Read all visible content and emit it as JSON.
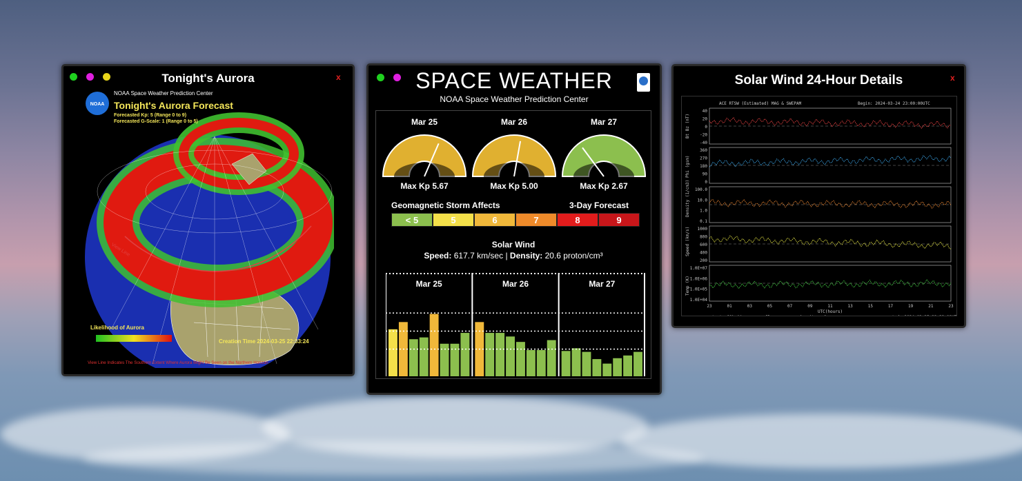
{
  "aurora_window": {
    "title": "Tonight's Aurora",
    "close": "x",
    "org": "NOAA Space Weather Prediction Center",
    "logo_text": "NOAA",
    "forecast_title": "Tonight's Aurora Forecast",
    "kp_line": "Forecasted Kp: 5 (Range 0 to 9)",
    "g_line": "Forecasted G-Scale: 1 (Range 0 to 5)",
    "likelihood_label": "Likelihood of Aurora",
    "view_line_label": "View Line",
    "creation_time": "Creation Time 2024-03-25 22:33:24",
    "footer": "View Line Indicates The Southern Extent Where Aurora Might Be Seen on the Northern Horizon"
  },
  "space_weather": {
    "title": "SPACE WEATHER",
    "subtitle": "NOAA Space Weather Prediction Center",
    "gauges": [
      {
        "date": "Mar 25",
        "kp_label": "Max Kp 5.67",
        "kp": 5.67,
        "color": "#e0b030"
      },
      {
        "date": "Mar 26",
        "kp_label": "Max Kp 5.00",
        "kp": 5.0,
        "color": "#e0b030"
      },
      {
        "date": "Mar 27",
        "kp_label": "Max Kp 2.67",
        "kp": 2.67,
        "color": "#8cbf4e"
      }
    ],
    "storm_label": "Geomagnetic Storm Affects",
    "forecast_label": "3-Day Forecast",
    "scale": [
      {
        "label": "< 5",
        "color": "#8cbf4e"
      },
      {
        "label": "5",
        "color": "#f4e04a"
      },
      {
        "label": "6",
        "color": "#f0b83a"
      },
      {
        "label": "7",
        "color": "#ee8a2a"
      },
      {
        "label": "8",
        "color": "#e21c1c"
      },
      {
        "label": "9",
        "color": "#c8161a"
      }
    ],
    "solar_wind_title": "Solar Wind",
    "speed_label": "Speed:",
    "speed_value": "617.7 km/sec",
    "separator": "|",
    "density_label": "Density:",
    "density_value": "20.6 proton/cm³",
    "bar_days": [
      "Mar 25",
      "Mar 26",
      "Mar 27"
    ],
    "kp_bars": [
      [
        5.2,
        6.0,
        4.1,
        4.3,
        6.9,
        3.6,
        3.6,
        4.8
      ],
      [
        6.0,
        4.8,
        4.8,
        4.4,
        3.8,
        2.9,
        2.9,
        4.0
      ],
      [
        2.8,
        3.1,
        2.7,
        1.9,
        1.4,
        2.0,
        2.3,
        2.7
      ]
    ]
  },
  "solar_wind_window": {
    "title": "Solar Wind 24-Hour Details",
    "close": "x",
    "plot_header_left": "ACE RTSW (Estimated) MAG & SWEPAM",
    "plot_header_right": "Begin: 2024-03-24 23:00:00UTC",
    "panels": [
      {
        "ylabel": "Bt Bz (nT)",
        "ticks": [
          "40",
          "20",
          "0",
          "-20",
          "-40"
        ],
        "color": "#e04040"
      },
      {
        "ylabel": "Phi (gsm)",
        "ticks": [
          "360",
          "270",
          "180",
          "90",
          "0"
        ],
        "color": "#3aa0e0"
      },
      {
        "ylabel": "Density (1/cm3)",
        "ticks": [
          "100.0",
          "10.0",
          "1.0",
          "0.1"
        ],
        "color": "#e08030"
      },
      {
        "ylabel": "Speed (km/s)",
        "ticks": [
          "1000",
          "800",
          "600",
          "400",
          "200"
        ],
        "color": "#d8d840"
      },
      {
        "ylabel": "Temp (K)",
        "ticks": [
          "1.0E+07",
          "1.0E+06",
          "1.0E+05",
          "1.0E+04"
        ],
        "color": "#40c040"
      }
    ],
    "x_ticks": [
      "23",
      "01",
      "03",
      "05",
      "07",
      "09",
      "11",
      "13",
      "15",
      "17",
      "19",
      "21",
      "23"
    ],
    "x_label": "UTC(hours)",
    "footer_start": "start: 60% #4",
    "footer_mid1": "magflux",
    "footer_mid2": "density < 1",
    "footer_created": "created: 2024-03-25 22:32:08UTC"
  }
}
